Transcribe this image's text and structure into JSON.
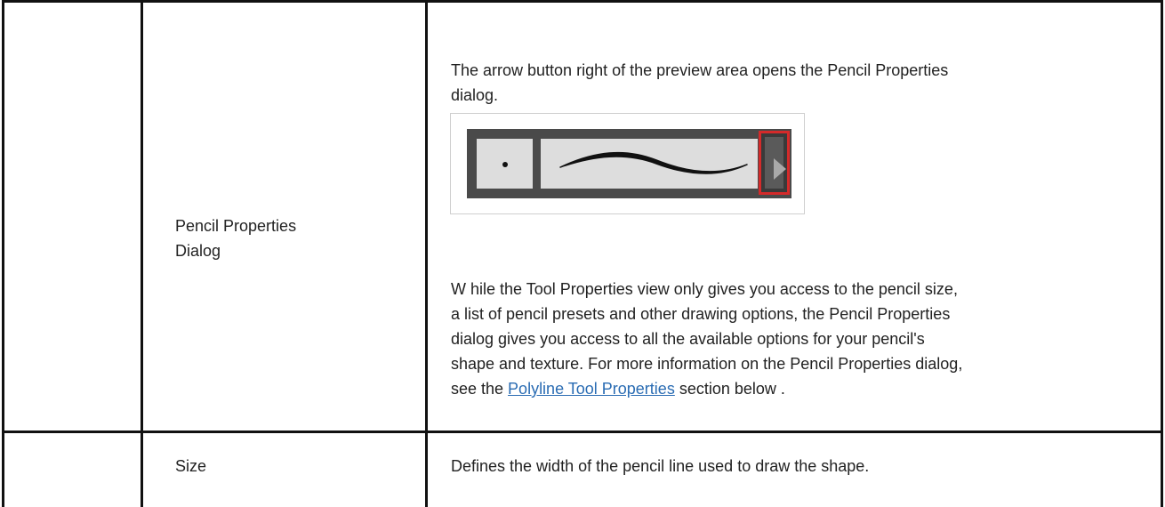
{
  "rows": [
    {
      "name": "Pencil Properties Dialog",
      "name_line1": "Pencil Properties",
      "name_line2": "Dialog",
      "intro_line1": "The arrow button right of the preview area opens the Pencil Properties",
      "intro_line2": "dialog.",
      "preview": {
        "icons": [
          "dot-icon",
          "brush-stroke-icon",
          "arrow-right-icon"
        ],
        "highlight_color": "#d42a2a"
      },
      "body_lines": [
        "W hile the Tool Properties view only gives you access to the pencil size,",
        "a list of pencil presets and other drawing options, the Pencil Properties",
        "dialog gives you access to all the available options for your pencil's",
        "shape and texture. For more information on the Pencil Properties dialog,"
      ],
      "see_prefix": "see the ",
      "link_text": "Polyline Tool Properties",
      "see_suffix": " section below ."
    },
    {
      "name": "Size",
      "description": "Defines the width of the pencil line used to draw the shape."
    }
  ],
  "colors": {
    "link": "#2a6cb3",
    "border": "#111111"
  }
}
